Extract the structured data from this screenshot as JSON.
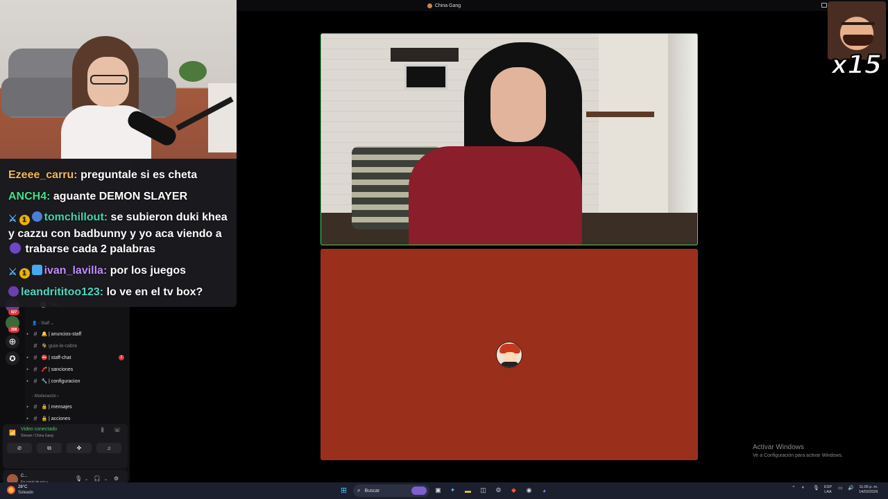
{
  "window": {
    "title": "China Gang"
  },
  "chat": {
    "messages": [
      {
        "user": "Ezeee_carru:",
        "user_color": "#f5b95a",
        "text": " preguntale si es cheta"
      },
      {
        "user": "ANCH4:",
        "user_color": "#46e08a",
        "text": " aguante DEMON SLAYER"
      },
      {
        "user": "tomchillout:",
        "user_color": "#3ed6a8",
        "text": " se subieron duki khea y cazzu con badbunny y yo aca viendo a ",
        "text_after_emote": " trabarse cada 2 palabras"
      },
      {
        "user": "ivan_lavilla:",
        "user_color": "#c48bff",
        "text": " por los juegos"
      },
      {
        "user": "leandrititoo123:",
        "user_color": "#4dd9c0",
        "text": " lo ve en el tv box?"
      }
    ]
  },
  "meme": {
    "multiplier": "x15"
  },
  "sidebar": {
    "rail_badges": [
      "927",
      "358"
    ],
    "voice_users": [
      "maru"
    ],
    "categories": {
      "staff": "Staff",
      "moderacion": "Moderación"
    },
    "channels": [
      {
        "name": "| anuncios-staff",
        "emoji": "🔔",
        "muted": false
      },
      {
        "name": "guia-la-cabra",
        "emoji": "🐐",
        "muted": true
      },
      {
        "name": "| staff-chat",
        "emoji": "⛔",
        "muted": false,
        "count": "2"
      },
      {
        "name": "| sanciones",
        "emoji": "🧨",
        "muted": false
      },
      {
        "name": "| configuracion",
        "emoji": "🔧",
        "muted": false
      },
      {
        "name": "| mensajes",
        "emoji": "🔒",
        "muted": false
      },
      {
        "name": "| acciones",
        "emoji": "🔒",
        "muted": false
      }
    ],
    "voice_panel": {
      "status": "Video conectado",
      "location": "Stream / China Gang"
    },
    "user_panel": {
      "name": "C...",
      "status": "En canal de voz •"
    }
  },
  "watermark": {
    "title": "Activar Windows",
    "subtitle": "Ve a Configuración para activar Windows."
  },
  "taskbar": {
    "weather_temp": "28°C",
    "weather_desc": "Soleado",
    "search_placeholder": "Buscar",
    "lang_1": "ESP",
    "lang_2": "LAA",
    "time": "11:06 p. m.",
    "date": "14/02/2026"
  },
  "colors": {
    "accent_green": "#3fd36b",
    "solid_tile": "#9a2f1c",
    "taskbar": "#1b1f2e"
  }
}
